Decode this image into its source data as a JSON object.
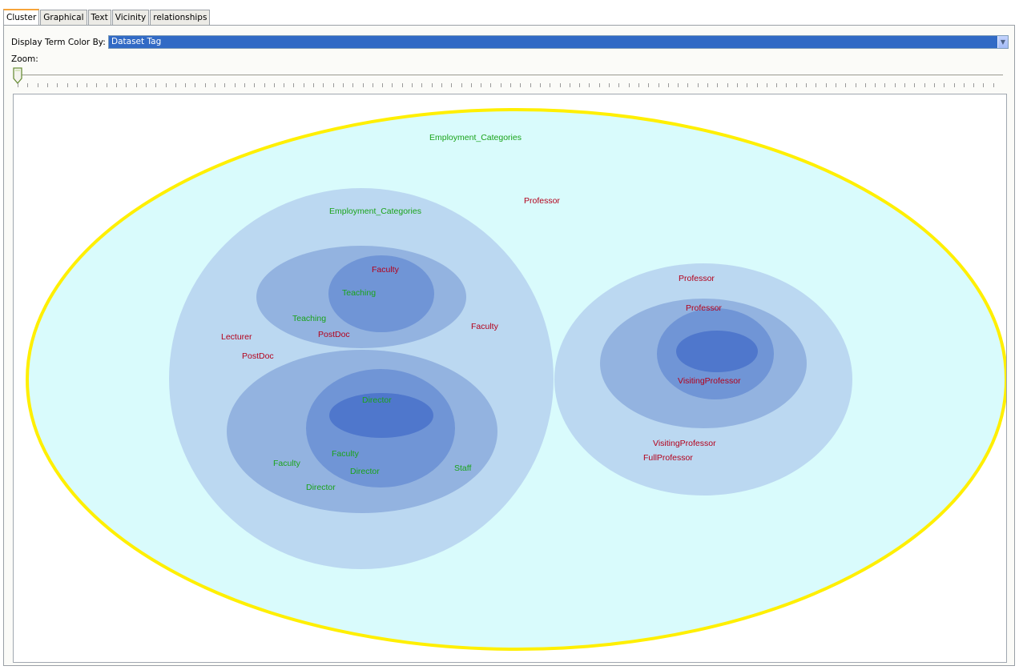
{
  "tabs": [
    {
      "label": "Cluster",
      "active": true
    },
    {
      "label": "Graphical",
      "active": false
    },
    {
      "label": "Text",
      "active": false
    },
    {
      "label": "Vicinity",
      "active": false
    },
    {
      "label": "relationships",
      "active": false
    }
  ],
  "controls": {
    "color_by_label": "Display Term Color By:",
    "color_by_value": "Dataset Tag",
    "zoom_label": "Zoom:",
    "zoom_level": 0
  },
  "colors": {
    "tag_green": "#1aa31a",
    "tag_red": "#b3001b",
    "outer_cluster_border": "#ffef00",
    "outer_cluster_fill": "#d9fbfc",
    "cluster_fill": "#b9d6f0",
    "selected_item_bg": "#316ac5"
  },
  "terms": {
    "outer_top": "Employment_Categories",
    "outer_professor": "Professor",
    "left_top": "Employment_Categories",
    "left_faculty_inner": "Faculty",
    "left_teaching_inner": "Teaching",
    "left_teaching": "Teaching",
    "left_postdoc_inner": "PostDoc",
    "left_faculty_right": "Faculty",
    "left_lecturer": "Lecturer",
    "left_postdoc": "PostDoc",
    "left_director_core": "Director",
    "left_faculty_bottom": "Faculty",
    "left_faculty_low": "Faculty",
    "left_director_mid": "Director",
    "left_staff": "Staff",
    "left_director_low": "Director",
    "right_professor_top": "Professor",
    "right_professor_mid": "Professor",
    "right_visiting_inner": "VisitingProfessor",
    "right_visiting": "VisitingProfessor",
    "right_full": "FullProfessor"
  }
}
